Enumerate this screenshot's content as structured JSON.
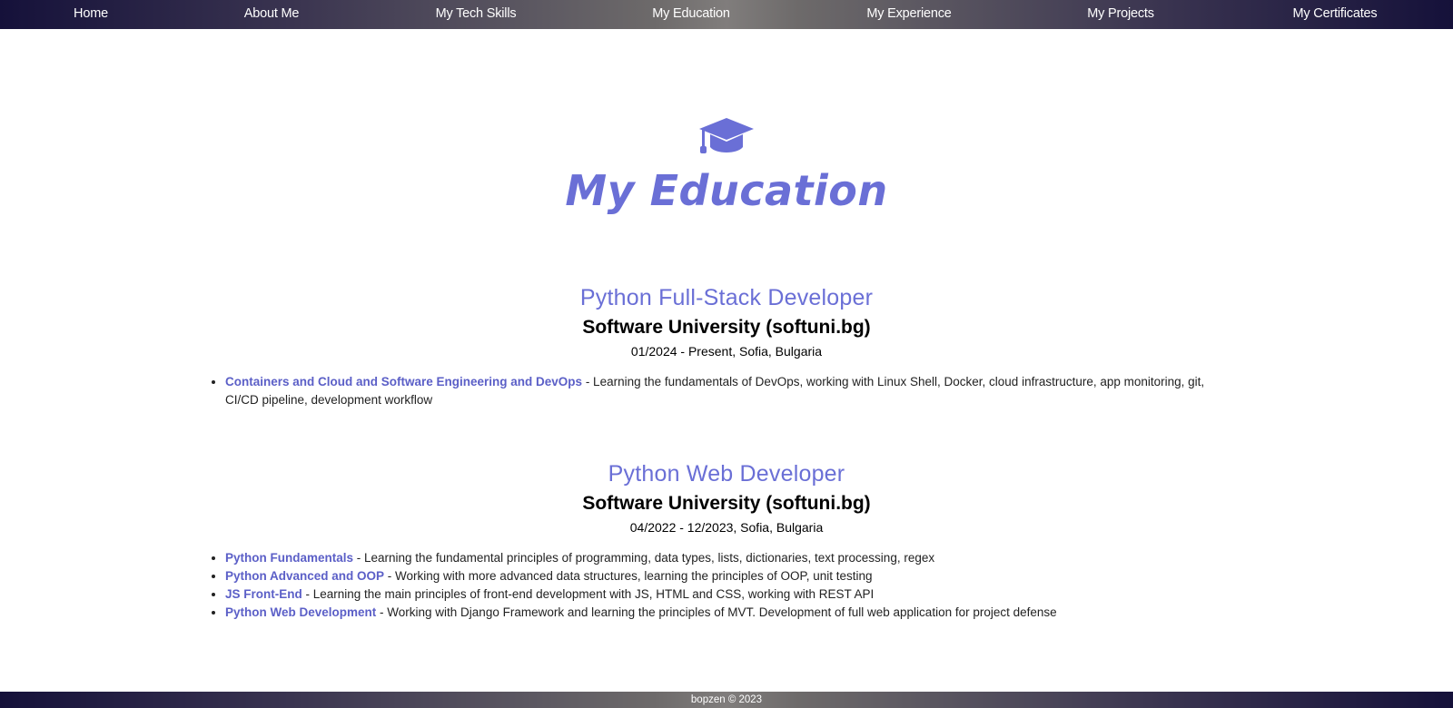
{
  "nav": {
    "items": [
      {
        "label": "Home"
      },
      {
        "label": "About Me"
      },
      {
        "label": "My Tech Skills"
      },
      {
        "label": "My Education"
      },
      {
        "label": "My Experience"
      },
      {
        "label": "My Projects"
      },
      {
        "label": "My Certificates"
      }
    ]
  },
  "page": {
    "icon": "graduation-cap-icon",
    "title": "My Education",
    "accent_color": "#6a6fd6"
  },
  "programs": [
    {
      "title": "Python Full-Stack Developer",
      "school": "Software University (softuni.bg)",
      "dates": "01/2024 - Present, Sofia, Bulgaria",
      "courses": [
        {
          "name": "Containers and Cloud and Software Engineering and DevOps",
          "description": " - Learning the fundamentals of DevOps, working with Linux Shell, Docker, cloud infrastructure, app monitoring, git, CI/CD pipeline, development workflow"
        }
      ]
    },
    {
      "title": "Python Web Developer",
      "school": "Software University (softuni.bg)",
      "dates": "04/2022 - 12/2023, Sofia, Bulgaria",
      "courses": [
        {
          "name": "Python Fundamentals",
          "description": " - Learning the fundamental principles of programming, data types, lists, dictionaries, text processing, regex"
        },
        {
          "name": "Python Advanced and OOP",
          "description": " - Working with more advanced data structures, learning the principles of OOP, unit testing"
        },
        {
          "name": "JS Front-End",
          "description": " - Learning the main principles of front-end development with JS, HTML and CSS, working with REST API"
        },
        {
          "name": "Python Web Development",
          "description": " - Working with Django Framework and learning the principles of MVT. Development of full web application for project defense"
        }
      ]
    }
  ],
  "footer": {
    "text": "bopzen © 2023"
  }
}
